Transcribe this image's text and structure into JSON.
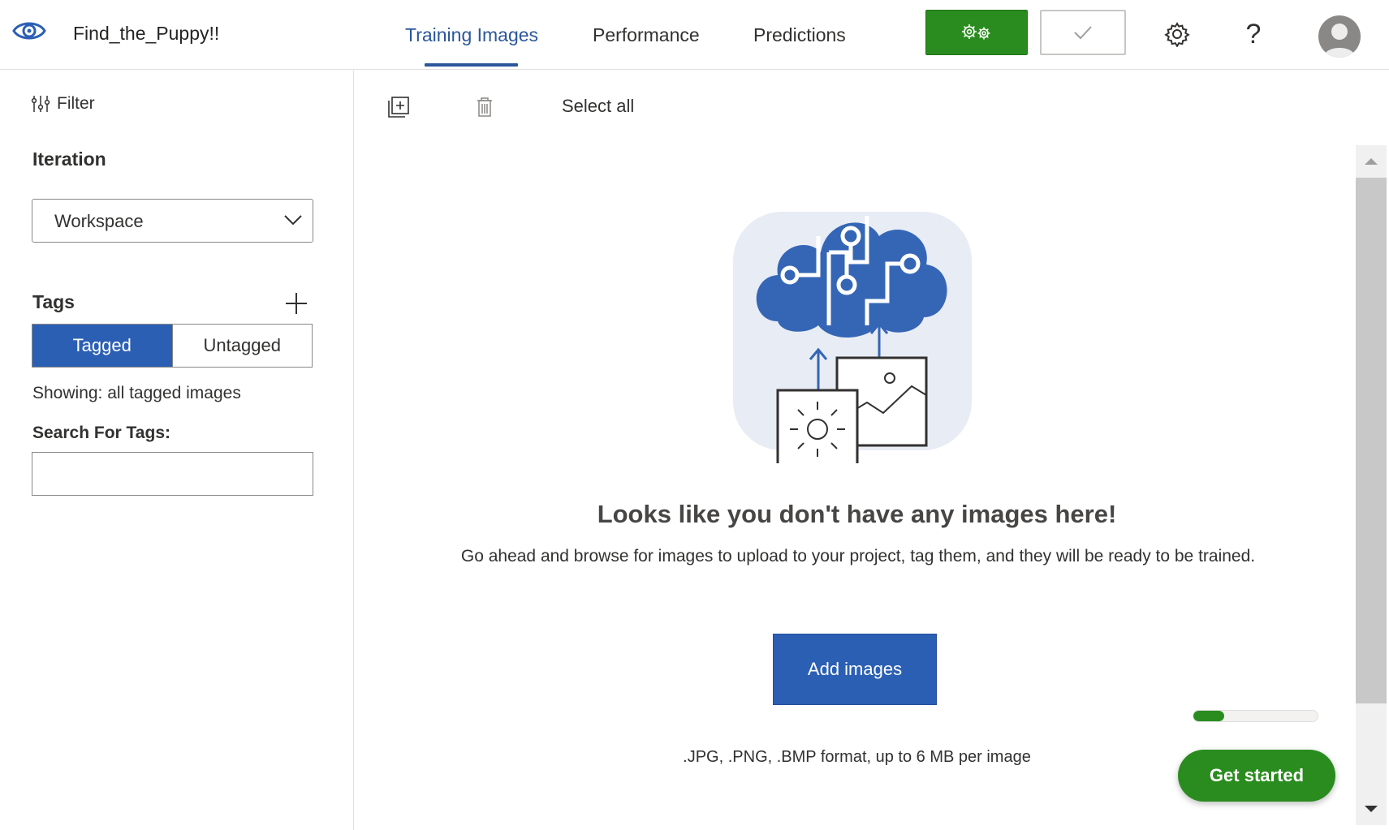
{
  "header": {
    "project_name": "Find_the_Puppy!!",
    "tabs": [
      {
        "label": "Training Images",
        "active": true
      },
      {
        "label": "Performance",
        "active": false
      },
      {
        "label": "Predictions",
        "active": false
      }
    ],
    "help_label": "?",
    "icons": {
      "logo": "eye-icon",
      "train": "gears-icon",
      "quick_test": "checkmark-icon",
      "settings": "gear-icon",
      "avatar": "user-avatar-icon"
    }
  },
  "sidebar": {
    "filter_label": "Filter",
    "iteration_label": "Iteration",
    "iteration_value": "Workspace",
    "tags_label": "Tags",
    "toggle": {
      "tagged": "Tagged",
      "untagged": "Untagged",
      "selected": "Tagged"
    },
    "showing_text": "Showing: all tagged images",
    "search_tags_label": "Search For Tags:",
    "search_tags_value": ""
  },
  "toolbar": {
    "select_all_label": "Select all",
    "icons": [
      "add-image-icon",
      "delete-icon"
    ]
  },
  "empty_state": {
    "title": "Looks like you don't have any images here!",
    "description": "Go ahead and browse for images to upload to your project, tag them, and they will be ready to be trained.",
    "add_button_label": "Add images",
    "format_note": ".JPG, .PNG, .BMP format, up to 6 MB per image"
  },
  "onboarding": {
    "progress": 0.25,
    "get_started_label": "Get started"
  },
  "colors": {
    "accent_blue": "#2b5fb4",
    "tab_active": "#2b579a",
    "green": "#2a8c1f"
  }
}
